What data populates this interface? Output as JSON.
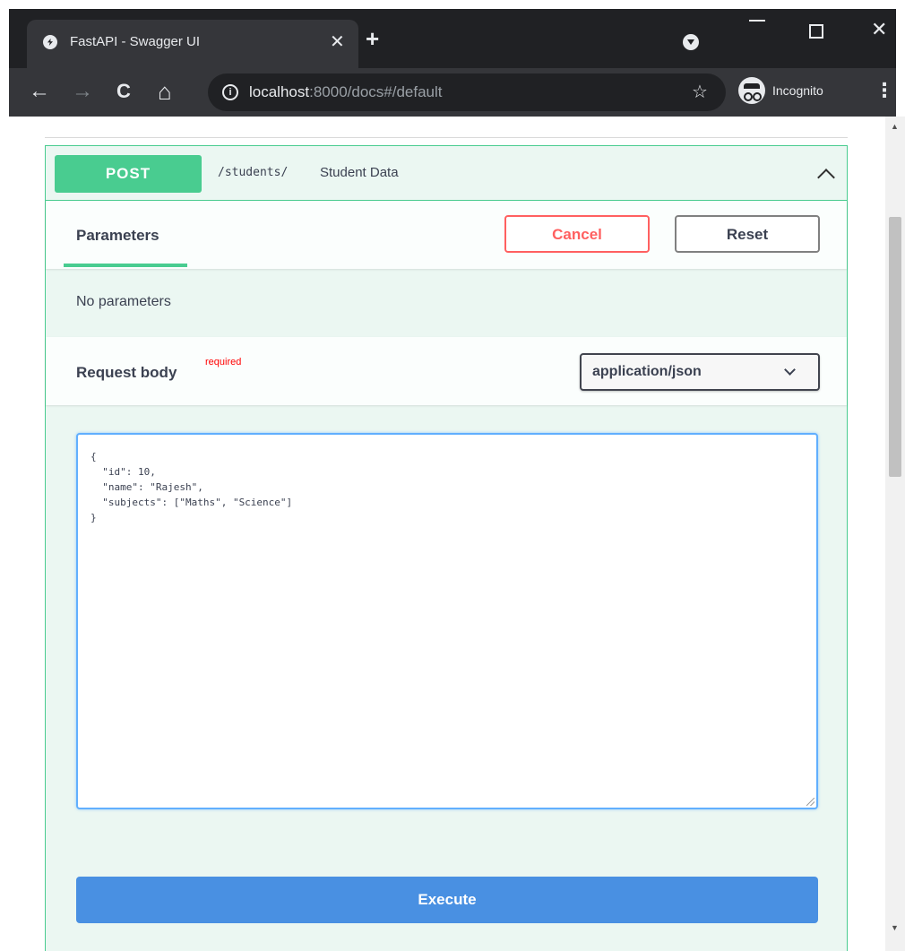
{
  "browser": {
    "tab_title": "FastAPI - Swagger UI",
    "tab_close": "✕",
    "new_tab": "+",
    "url_host": "localhost",
    "url_rest": ":8000/docs#/default",
    "incognito_label": "Incognito",
    "icons": {
      "back": "←",
      "forward": "→",
      "reload": "C",
      "home": "⌂",
      "star": "☆",
      "menu": "⋮",
      "close": "✕",
      "minimize": "—"
    }
  },
  "operation": {
    "method": "POST",
    "path": "/students/",
    "summary": "Student Data"
  },
  "parameters": {
    "tab_label": "Parameters",
    "cancel_label": "Cancel",
    "reset_label": "Reset",
    "empty_text": "No parameters"
  },
  "request_body": {
    "title": "Request body",
    "required_label": "required",
    "content_type": "application/json",
    "code": "{\n  \"id\": 10,\n  \"name\": \"Rajesh\",\n  \"subjects\": [\"Maths\", \"Science\"]\n}"
  },
  "execute_label": "Execute",
  "colors": {
    "post_green": "#49cc90",
    "block_bg": "#ebf7f2",
    "cancel_red": "#ff6060",
    "execute_blue": "#4990e2",
    "chrome_dark": "#202124"
  }
}
